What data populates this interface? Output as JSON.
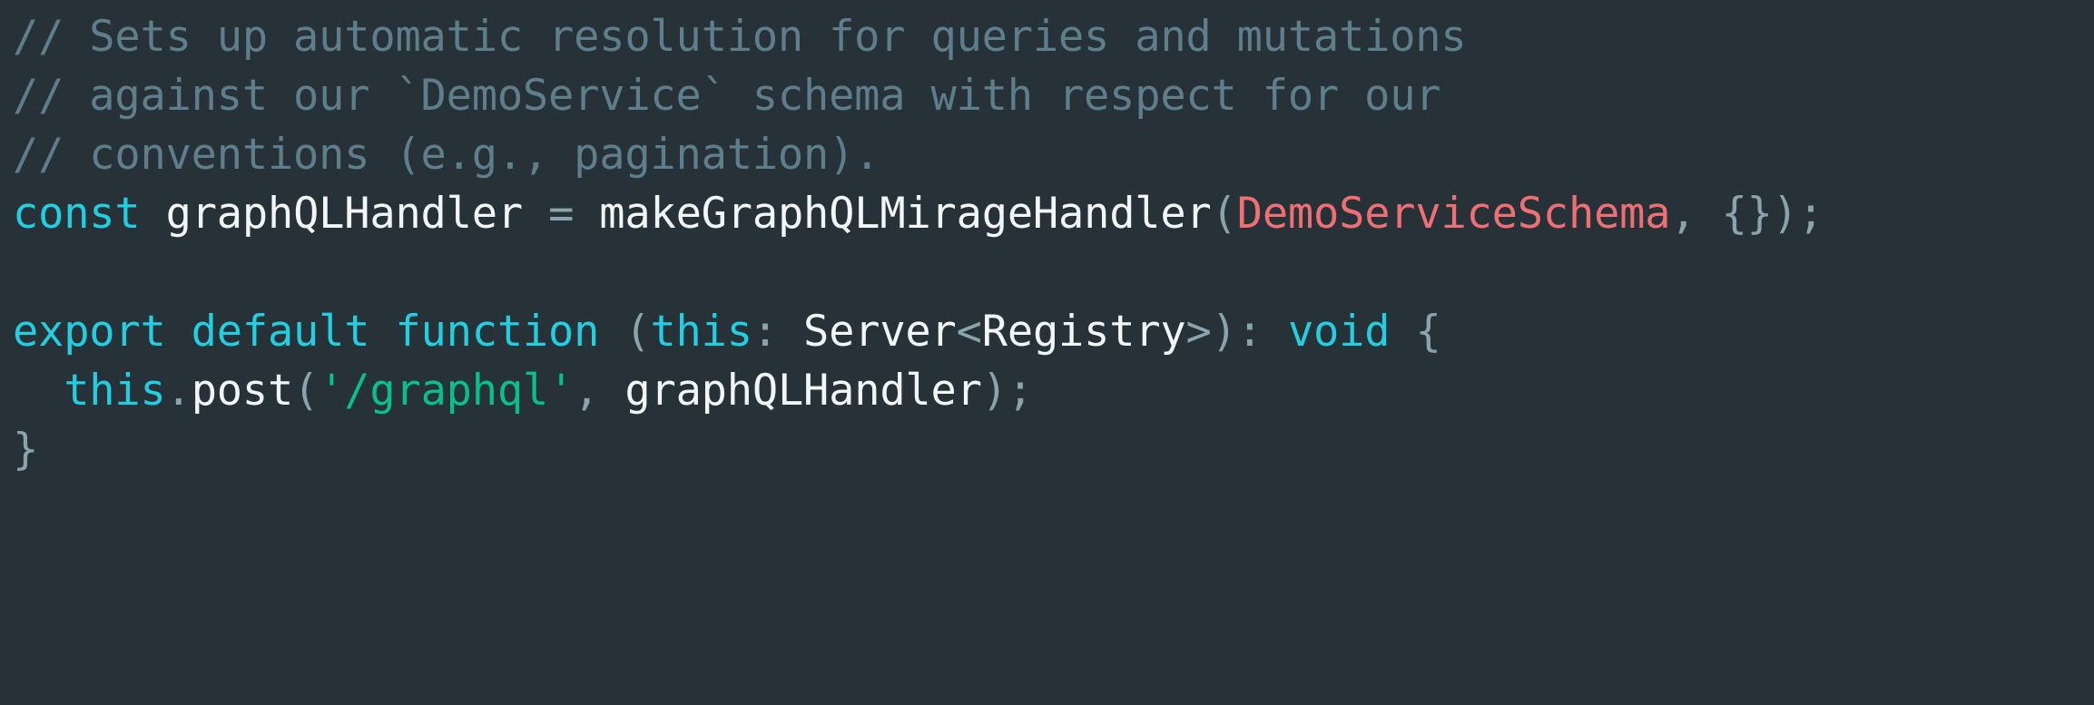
{
  "editor": {
    "language": "typescript",
    "background_color": "#263238",
    "font_size_px": 47,
    "line_height_px": 65,
    "theme_colors": {
      "comment": "#5f7e8c",
      "keyword": "#21cfe0",
      "identifier": "#f2f6f7",
      "punctuation": "#8aa4ae",
      "type": "#ef6f74",
      "string": "#08bf8d",
      "background": "#263238"
    }
  },
  "code": {
    "lines": [
      {
        "index": 1,
        "text": "// Sets up automatic resolution for queries and mutations",
        "tokens": [
          {
            "t": "// Sets up automatic resolution for queries and mutations",
            "c": "comment"
          }
        ]
      },
      {
        "index": 2,
        "text": "// against our `DemoService` schema with respect for our",
        "tokens": [
          {
            "t": "// against our `DemoService` schema with respect for our",
            "c": "comment"
          }
        ]
      },
      {
        "index": 3,
        "text": "// conventions (e.g., pagination).",
        "tokens": [
          {
            "t": "// conventions (e.g., pagination).",
            "c": "comment"
          }
        ]
      },
      {
        "index": 4,
        "text": "const graphQLHandler = makeGraphQLMirageHandler(DemoServiceSchema, {});",
        "tokens": [
          {
            "t": "const",
            "c": "keyword"
          },
          {
            "t": " ",
            "c": "plain"
          },
          {
            "t": "graphQLHandler",
            "c": "ident"
          },
          {
            "t": " ",
            "c": "plain"
          },
          {
            "t": "=",
            "c": "op"
          },
          {
            "t": " ",
            "c": "plain"
          },
          {
            "t": "makeGraphQLMirageHandler",
            "c": "ident"
          },
          {
            "t": "(",
            "c": "punct"
          },
          {
            "t": "DemoServiceSchema",
            "c": "type"
          },
          {
            "t": ", ",
            "c": "punct"
          },
          {
            "t": "{});",
            "c": "punct"
          }
        ]
      },
      {
        "index": 5,
        "text": "",
        "tokens": [
          {
            "t": " ",
            "c": "blank"
          }
        ]
      },
      {
        "index": 6,
        "text": "export default function (this: Server<Registry>): void {",
        "tokens": [
          {
            "t": "export default function",
            "c": "keyword"
          },
          {
            "t": " ",
            "c": "plain"
          },
          {
            "t": "(",
            "c": "punct"
          },
          {
            "t": "this",
            "c": "keyword"
          },
          {
            "t": ":",
            "c": "punct"
          },
          {
            "t": " ",
            "c": "plain"
          },
          {
            "t": "Server",
            "c": "ident"
          },
          {
            "t": "<",
            "c": "punct"
          },
          {
            "t": "Registry",
            "c": "ident"
          },
          {
            "t": ">",
            "c": "punct"
          },
          {
            "t": "):",
            "c": "punct"
          },
          {
            "t": " ",
            "c": "plain"
          },
          {
            "t": "void",
            "c": "keyword"
          },
          {
            "t": " ",
            "c": "plain"
          },
          {
            "t": "{",
            "c": "punct"
          }
        ]
      },
      {
        "index": 7,
        "text": "  this.post('/graphql', graphQLHandler);",
        "tokens": [
          {
            "t": "  ",
            "c": "plain"
          },
          {
            "t": "this",
            "c": "keyword"
          },
          {
            "t": ".",
            "c": "punct"
          },
          {
            "t": "post",
            "c": "ident"
          },
          {
            "t": "(",
            "c": "punct"
          },
          {
            "t": "'/graphql'",
            "c": "string"
          },
          {
            "t": ", ",
            "c": "punct"
          },
          {
            "t": "graphQLHandler",
            "c": "ident"
          },
          {
            "t": ");",
            "c": "punct"
          }
        ]
      },
      {
        "index": 8,
        "text": "}",
        "tokens": [
          {
            "t": "}",
            "c": "punct"
          }
        ]
      }
    ]
  }
}
